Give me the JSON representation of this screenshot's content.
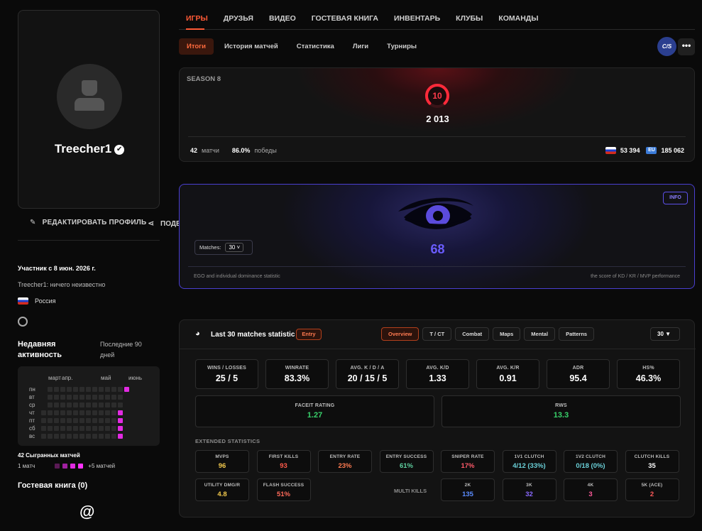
{
  "profile": {
    "username": "Treecher1",
    "verified_glyph": "✔",
    "edit_label": "РЕДАКТИРОВАТЬ ПРОФИЛЬ",
    "share_label": "ПОДЕЛИТЬСЯ",
    "member_since": "Участник с 8 июн. 2026 г.",
    "bio": "Treecher1: ничего неизвестно",
    "country": "Россия",
    "recent_activity_title": "Недавняя активность",
    "recent_activity_range": "Последние 90 дней",
    "heatmap_months": [
      "март",
      "апр.",
      "май",
      "июнь"
    ],
    "heatmap_days": [
      "пн",
      "вт",
      "ср",
      "чт",
      "пт",
      "сб",
      "вс"
    ],
    "matches_played": "42 Сыгранных матчей",
    "legend_min": "1 матч",
    "legend_max": "+5 матчей",
    "guestbook": "Гостевая книга (0)",
    "guestbook_icon": "@"
  },
  "nav": {
    "main": [
      "ИГРЫ",
      "ДРУЗЬЯ",
      "ВИДЕО",
      "ГОСТЕВАЯ КНИГА",
      "ИНВЕНТАРЬ",
      "КЛУБЫ",
      "КОМАНДЫ"
    ],
    "sub": [
      "Итоги",
      "История матчей",
      "Статистика",
      "Лиги",
      "Турниры"
    ],
    "game_badge": "C/S",
    "more": "•••"
  },
  "season": {
    "title": "SEASON 8",
    "level": "10",
    "elo": "2 013",
    "matches_value": "42",
    "matches_label": "матчи",
    "winrate_value": "86.0%",
    "winrate_label": "победы",
    "country_rank": "53 394",
    "region_rank": "185 062",
    "region_icon": "EU"
  },
  "ego": {
    "info": "INFO",
    "score": "68",
    "matches_label": "Matches:",
    "matches_value": "30 ˅",
    "left_note": "EGO and individual dominance statistic",
    "right_note": "the score of KD / KR / MVP performance"
  },
  "stats": {
    "title": "Last 30 matches statistic",
    "badge": "Entry",
    "tabs": [
      "Overview",
      "T / CT",
      "Combat",
      "Maps",
      "Mental",
      "Patterns"
    ],
    "count": "30  ▼",
    "top": [
      {
        "label": "WINS / LOSSES",
        "value": "25 / 5"
      },
      {
        "label": "WINRATE",
        "value": "83.3%"
      },
      {
        "label": "AVG. K / D / A",
        "value": "20 / 15 / 5"
      },
      {
        "label": "AVG. K/D",
        "value": "1.33"
      },
      {
        "label": "AVG. K/R",
        "value": "0.91"
      },
      {
        "label": "ADR",
        "value": "95.4"
      },
      {
        "label": "HS%",
        "value": "46.3%"
      }
    ],
    "ratings": [
      {
        "label": "FACEIT RATING",
        "value": "1.27"
      },
      {
        "label": "RWS",
        "value": "13.3"
      }
    ],
    "extended_title": "EXTENDED STATISTICS",
    "extended": [
      {
        "label": "MVPS",
        "value": "96",
        "color": "#f2c94c"
      },
      {
        "label": "FIRST KILLS",
        "value": "93",
        "color": "#ff5a4a"
      },
      {
        "label": "ENTRY RATE",
        "value": "23%",
        "color": "#ff7b51"
      },
      {
        "label": "ENTRY SUCCESS",
        "value": "61%",
        "color": "#5fd0a0"
      },
      {
        "label": "SNIPER RATE",
        "value": "17%",
        "color": "#ff5a6a"
      },
      {
        "label": "1V1 CLUTCH",
        "value": "4/12 (33%)",
        "color": "#6ad0d8"
      },
      {
        "label": "1V2 CLUTCH",
        "value": "0/18 (0%)",
        "color": "#6ad0d8"
      },
      {
        "label": "CLUTCH KILLS",
        "value": "35",
        "color": "#ffffff"
      }
    ],
    "extended2": [
      {
        "label": "UTILITY DMG/R",
        "value": "4.8",
        "color": "#f2c94c"
      },
      {
        "label": "FLASH SUCCESS",
        "value": "51%",
        "color": "#ff6a5a"
      }
    ],
    "multi_kills_label": "MULTI KILLS",
    "multi": [
      {
        "label": "2K",
        "value": "135",
        "color": "#5b8cff"
      },
      {
        "label": "3K",
        "value": "32",
        "color": "#8a6aff"
      },
      {
        "label": "4K",
        "value": "3",
        "color": "#ff5a9a"
      },
      {
        "label": "5K (ACE)",
        "value": "2",
        "color": "#ff5a5a"
      }
    ]
  }
}
